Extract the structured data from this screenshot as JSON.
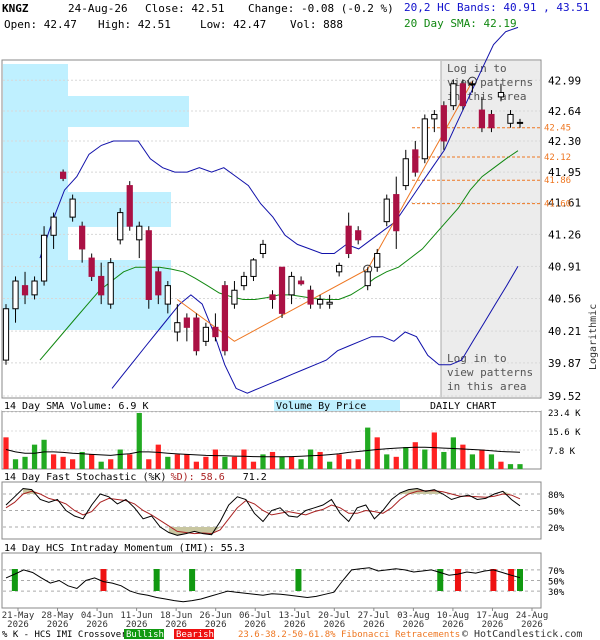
{
  "header": {
    "symbol": "KNGZ",
    "date": "24-Aug-26",
    "close": "Close: 42.51",
    "change": "Change: -0.08 (-0.2 %)",
    "open": "Open: 42.47",
    "high": "High: 42.51",
    "low": "Low: 42.47",
    "vol": "Vol: 888",
    "bands_legend": "20,2 HC Bands: 40.91 , 43.51",
    "sma_legend": "20 Day SMA: 42.19"
  },
  "colors": {
    "up": "#ffffff",
    "down": "#aa1144",
    "volume_up": "#22aa22",
    "volume_down": "#ff2222",
    "bands": "#1111aa",
    "sma": "#118811",
    "fib": "#ee7722",
    "vbp": "#bff0ff",
    "stoch_k": "#000000",
    "stoch_d": "#aa2222",
    "stoch_fill": "#c8c6a0"
  },
  "panels": {
    "volume_title": "14 Day SMA Volume: 6.9 K",
    "vbp_label": "Volume By Price",
    "daily_label": "DAILY CHART",
    "stoch_title_a": "14 Day Fast Stochastic (%K)",
    "stoch_title_b": "%D): 58.6",
    "stoch_title_c": "71.2",
    "imi_title": "14 Day HCS Intraday Momentum (IMI): 55.3",
    "login_text_1": [
      "Log in to",
      "view patterns",
      "in this area"
    ],
    "login_text_2": [
      "Log in to",
      "view patterns",
      "in this area"
    ],
    "log_label": "Logarithmic"
  },
  "footer": {
    "crossover_label": "% K - HCS IMI Crossover:",
    "bullish": "Bullish",
    "bearish": "Bearish",
    "fib_label": "23.6-38.2-50-61.8% Fibonacci Retracements",
    "copyright": "© HotCandlestick.com"
  },
  "chart_data": {
    "type": "candlestick",
    "y_scale": "log",
    "price_ticks": [
      "42.99",
      "42.64",
      "42.30",
      "41.95",
      "41.61",
      "41.26",
      "40.91",
      "40.56",
      "40.21",
      "39.87",
      "39.52"
    ],
    "price_range": [
      39.52,
      43.2
    ],
    "fib_levels": [
      {
        "label": "42.45",
        "price": 42.45
      },
      {
        "label": "42.12",
        "price": 42.12
      },
      {
        "label": "41.86",
        "price": 41.86
      },
      {
        "label": "41.60",
        "price": 41.6
      }
    ],
    "x_labels": [
      [
        "21-May",
        "2026"
      ],
      [
        "28-May",
        "2026"
      ],
      [
        "04-Jun",
        "2026"
      ],
      [
        "11-Jun",
        "2026"
      ],
      [
        "18-Jun",
        "2026"
      ],
      [
        "26-Jun",
        "2026"
      ],
      [
        "06-Jul",
        "2026"
      ],
      [
        "13-Jul",
        "2026"
      ],
      [
        "20-Jul",
        "2026"
      ],
      [
        "27-Jul",
        "2026"
      ],
      [
        "03-Aug",
        "2026"
      ],
      [
        "10-Aug",
        "2026"
      ],
      [
        "17-Aug",
        "2026"
      ],
      [
        "24-Aug",
        "2026"
      ]
    ],
    "candles": [
      {
        "o": 39.9,
        "h": 40.5,
        "l": 39.85,
        "c": 40.45
      },
      {
        "o": 40.45,
        "h": 40.8,
        "l": 40.3,
        "c": 40.75
      },
      {
        "o": 40.7,
        "h": 40.85,
        "l": 40.5,
        "c": 40.6
      },
      {
        "o": 40.6,
        "h": 40.8,
        "l": 40.55,
        "c": 40.75
      },
      {
        "o": 40.75,
        "h": 41.35,
        "l": 40.7,
        "c": 41.25
      },
      {
        "o": 41.25,
        "h": 41.5,
        "l": 41.1,
        "c": 41.45
      },
      {
        "o": 41.95,
        "h": 41.98,
        "l": 41.85,
        "c": 41.88
      },
      {
        "o": 41.45,
        "h": 41.7,
        "l": 41.4,
        "c": 41.65
      },
      {
        "o": 41.35,
        "h": 41.4,
        "l": 40.95,
        "c": 41.1
      },
      {
        "o": 41.0,
        "h": 41.05,
        "l": 40.75,
        "c": 40.8
      },
      {
        "o": 40.8,
        "h": 40.95,
        "l": 40.5,
        "c": 40.6
      },
      {
        "o": 40.5,
        "h": 41.0,
        "l": 40.45,
        "c": 40.95
      },
      {
        "o": 41.2,
        "h": 41.55,
        "l": 41.15,
        "c": 41.5
      },
      {
        "o": 41.8,
        "h": 41.85,
        "l": 41.3,
        "c": 41.35
      },
      {
        "o": 41.2,
        "h": 41.4,
        "l": 41.0,
        "c": 41.35
      },
      {
        "o": 41.3,
        "h": 41.35,
        "l": 40.45,
        "c": 40.55
      },
      {
        "o": 40.85,
        "h": 40.9,
        "l": 40.5,
        "c": 40.6
      },
      {
        "o": 40.5,
        "h": 40.75,
        "l": 40.4,
        "c": 40.7
      },
      {
        "o": 40.2,
        "h": 40.5,
        "l": 40.1,
        "c": 40.3
      },
      {
        "o": 40.35,
        "h": 40.4,
        "l": 40.1,
        "c": 40.25
      },
      {
        "o": 40.35,
        "h": 40.4,
        "l": 39.95,
        "c": 40.0
      },
      {
        "o": 40.1,
        "h": 40.3,
        "l": 40.05,
        "c": 40.25
      },
      {
        "o": 40.25,
        "h": 40.4,
        "l": 40.1,
        "c": 40.15
      },
      {
        "o": 40.7,
        "h": 40.75,
        "l": 39.95,
        "c": 40.0
      },
      {
        "o": 40.5,
        "h": 40.75,
        "l": 40.45,
        "c": 40.65
      },
      {
        "o": 40.7,
        "h": 40.85,
        "l": 40.65,
        "c": 40.8
      },
      {
        "o": 40.8,
        "h": 41.0,
        "l": 40.75,
        "c": 40.98
      },
      {
        "o": 41.05,
        "h": 41.2,
        "l": 41.0,
        "c": 41.15
      },
      {
        "o": 40.6,
        "h": 40.65,
        "l": 40.45,
        "c": 40.55
      },
      {
        "o": 40.9,
        "h": 40.9,
        "l": 40.35,
        "c": 40.4
      },
      {
        "o": 40.6,
        "h": 40.85,
        "l": 40.5,
        "c": 40.8
      },
      {
        "o": 40.75,
        "h": 40.8,
        "l": 40.7,
        "c": 40.72
      },
      {
        "o": 40.65,
        "h": 40.7,
        "l": 40.45,
        "c": 40.5
      },
      {
        "o": 40.5,
        "h": 40.6,
        "l": 40.45,
        "c": 40.55
      },
      {
        "o": 40.5,
        "h": 40.6,
        "l": 40.45,
        "c": 40.52
      },
      {
        "o": 40.85,
        "h": 40.95,
        "l": 40.8,
        "c": 40.92
      },
      {
        "o": 41.35,
        "h": 41.5,
        "l": 41.0,
        "c": 41.05
      },
      {
        "o": 41.3,
        "h": 41.35,
        "l": 41.15,
        "c": 41.2
      },
      {
        "o": 40.7,
        "h": 40.9,
        "l": 40.65,
        "c": 40.85
      },
      {
        "o": 40.9,
        "h": 41.1,
        "l": 40.85,
        "c": 41.05
      },
      {
        "o": 41.4,
        "h": 41.7,
        "l": 41.35,
        "c": 41.65
      },
      {
        "o": 41.7,
        "h": 41.9,
        "l": 41.1,
        "c": 41.3
      },
      {
        "o": 41.8,
        "h": 42.2,
        "l": 41.75,
        "c": 42.1
      },
      {
        "o": 42.2,
        "h": 42.3,
        "l": 41.9,
        "c": 41.95
      },
      {
        "o": 42.1,
        "h": 42.6,
        "l": 42.05,
        "c": 42.55
      },
      {
        "o": 42.55,
        "h": 42.65,
        "l": 42.4,
        "c": 42.6
      },
      {
        "o": 42.7,
        "h": 42.75,
        "l": 42.2,
        "c": 42.3
      },
      {
        "o": 42.7,
        "h": 43.0,
        "l": 42.65,
        "c": 42.95
      },
      {
        "o": 42.95,
        "h": 43.0,
        "l": 42.65,
        "c": 42.7
      },
      {
        "o": 42.95,
        "h": 42.98,
        "l": 42.85,
        "c": 42.95
      },
      {
        "o": 42.65,
        "h": 42.8,
        "l": 42.4,
        "c": 42.45
      },
      {
        "o": 42.6,
        "h": 42.65,
        "l": 42.4,
        "c": 42.45
      },
      {
        "o": 42.8,
        "h": 42.95,
        "l": 42.75,
        "c": 42.85
      },
      {
        "o": 42.5,
        "h": 42.65,
        "l": 42.45,
        "c": 42.6
      },
      {
        "o": 42.5,
        "h": 42.55,
        "l": 42.45,
        "c": 42.51
      }
    ],
    "upper_band": [
      41.0,
      41.4,
      41.75,
      41.9,
      42.15,
      42.25,
      42.3,
      42.3,
      42.3,
      42.1,
      42.0,
      41.95,
      41.95,
      42.0,
      41.95,
      42.0,
      41.9,
      41.8,
      41.6,
      41.45,
      41.25,
      41.15,
      41.1,
      41.05,
      41.05,
      41.15,
      41.1,
      41.2,
      41.3,
      41.4,
      41.6,
      41.8,
      42.0,
      42.2,
      42.5,
      42.8,
      43.1,
      43.4,
      43.55,
      43.6
    ],
    "sma": [
      39.9,
      40.05,
      40.2,
      40.35,
      40.5,
      40.65,
      40.75,
      40.85,
      40.9,
      40.9,
      40.9,
      40.88,
      40.85,
      40.78,
      40.7,
      40.62,
      40.58,
      40.55,
      40.55,
      40.57,
      40.6,
      40.6,
      40.58,
      40.56,
      40.55,
      40.55,
      40.6,
      40.68,
      40.78,
      40.85,
      40.9,
      41.0,
      41.1,
      41.25,
      41.4,
      41.55,
      41.75,
      41.9,
      42.0,
      42.1,
      42.19
    ],
    "lower_band": [
      39.6,
      39.75,
      39.9,
      40.05,
      40.2,
      40.35,
      40.5,
      40.6,
      40.5,
      40.2,
      39.85,
      39.6,
      39.55,
      39.6,
      39.65,
      39.7,
      39.75,
      39.8,
      39.85,
      39.9,
      40.0,
      40.05,
      40.1,
      40.15,
      40.15,
      40.1,
      40.2,
      40.15,
      39.95,
      39.85,
      39.85,
      39.9,
      40.1,
      40.3,
      40.5,
      40.7,
      40.91
    ],
    "fib_line": [
      [
        18,
        40.55
      ],
      [
        24,
        40.1
      ],
      [
        38,
        40.88
      ],
      [
        49,
        42.98
      ]
    ],
    "volume_ticks": [
      "23.4 K",
      "15.6 K",
      "7.8 K"
    ],
    "volume_range": [
      0,
      23.4
    ],
    "volume": [
      {
        "v": 13,
        "up": false
      },
      {
        "v": 4,
        "up": true
      },
      {
        "v": 5,
        "up": true
      },
      {
        "v": 10,
        "up": true
      },
      {
        "v": 12,
        "up": true
      },
      {
        "v": 6,
        "up": false
      },
      {
        "v": 5,
        "up": false
      },
      {
        "v": 4,
        "up": false
      },
      {
        "v": 7,
        "up": true
      },
      {
        "v": 6,
        "up": false
      },
      {
        "v": 3,
        "up": true
      },
      {
        "v": 4,
        "up": false
      },
      {
        "v": 8,
        "up": true
      },
      {
        "v": 6,
        "up": false
      },
      {
        "v": 23,
        "up": true
      },
      {
        "v": 4,
        "up": false
      },
      {
        "v": 10,
        "up": false
      },
      {
        "v": 5,
        "up": true
      },
      {
        "v": 6,
        "up": false
      },
      {
        "v": 6,
        "up": false
      },
      {
        "v": 3,
        "up": false
      },
      {
        "v": 5,
        "up": false
      },
      {
        "v": 8,
        "up": false
      },
      {
        "v": 5,
        "up": true
      },
      {
        "v": 5,
        "up": false
      },
      {
        "v": 8,
        "up": false
      },
      {
        "v": 3,
        "up": false
      },
      {
        "v": 6,
        "up": true
      },
      {
        "v": 7,
        "up": false
      },
      {
        "v": 5,
        "up": true
      },
      {
        "v": 5,
        "up": false
      },
      {
        "v": 4,
        "up": true
      },
      {
        "v": 8,
        "up": true
      },
      {
        "v": 7,
        "up": false
      },
      {
        "v": 3,
        "up": true
      },
      {
        "v": 6,
        "up": false
      },
      {
        "v": 4,
        "up": false
      },
      {
        "v": 4,
        "up": false
      },
      {
        "v": 17,
        "up": true
      },
      {
        "v": 13,
        "up": false
      },
      {
        "v": 6,
        "up": true
      },
      {
        "v": 5,
        "up": false
      },
      {
        "v": 9,
        "up": true
      },
      {
        "v": 11,
        "up": false
      },
      {
        "v": 8,
        "up": true
      },
      {
        "v": 15,
        "up": false
      },
      {
        "v": 7,
        "up": true
      },
      {
        "v": 13,
        "up": true
      },
      {
        "v": 10,
        "up": false
      },
      {
        "v": 6,
        "up": true
      },
      {
        "v": 8,
        "up": false
      },
      {
        "v": 6,
        "up": true
      },
      {
        "v": 3,
        "up": false
      },
      {
        "v": 2,
        "up": true
      },
      {
        "v": 2,
        "up": true
      }
    ],
    "volume_sma": [
      8,
      7,
      6.5,
      6.5,
      7,
      7,
      6.8,
      6.5,
      6.3,
      6,
      5.8,
      5.6,
      6,
      6.3,
      7,
      7,
      6.8,
      6.5,
      6.2,
      6,
      5.8,
      5.6,
      5.5,
      5.4,
      5.3,
      5.2,
      5.1,
      5,
      5,
      5,
      5.1,
      5.2,
      5.4,
      5.6,
      5.9,
      6.3,
      6.8,
      7.2,
      7.6,
      8,
      8.3,
      8.6,
      8.8,
      8.9,
      8.9,
      8.8,
      8.6,
      8.4,
      8.2,
      8,
      7.8,
      7.5,
      7.2,
      7,
      6.9
    ],
    "stoch_ticks": [
      "80%",
      "50%",
      "20%"
    ],
    "stoch_k": [
      60,
      75,
      90,
      88,
      70,
      65,
      70,
      50,
      40,
      35,
      60,
      80,
      75,
      62,
      70,
      55,
      35,
      40,
      20,
      10,
      5,
      8,
      12,
      8,
      6,
      30,
      60,
      75,
      70,
      45,
      30,
      50,
      55,
      40,
      38,
      50,
      55,
      60,
      70,
      45,
      30,
      55,
      60,
      35,
      50,
      70,
      82,
      88,
      90,
      85,
      88,
      80,
      70,
      75,
      78,
      70,
      72,
      80,
      85,
      70,
      58.6
    ],
    "stoch_d": [
      55,
      65,
      80,
      85,
      80,
      72,
      68,
      62,
      50,
      42,
      48,
      65,
      72,
      70,
      68,
      62,
      50,
      42,
      32,
      22,
      12,
      10,
      8,
      9,
      8,
      15,
      35,
      55,
      68,
      62,
      50,
      42,
      45,
      48,
      45,
      42,
      48,
      52,
      60,
      55,
      45,
      45,
      50,
      48,
      45,
      55,
      70,
      80,
      85,
      86,
      86,
      84,
      80,
      76,
      76,
      75,
      74,
      76,
      80,
      78,
      71.2
    ],
    "imi_ticks": [
      "70%",
      "50%",
      "30%"
    ],
    "imi": [
      55,
      62,
      70,
      65,
      55,
      45,
      50,
      40,
      35,
      50,
      55,
      48,
      45,
      40,
      30,
      25,
      22,
      18,
      15,
      12,
      10,
      12,
      15,
      20,
      25,
      30,
      28,
      26,
      24,
      22,
      25,
      24,
      22,
      20,
      18,
      20,
      24,
      28,
      50,
      70,
      72,
      74,
      68,
      70,
      72,
      70,
      66,
      68,
      70,
      65,
      60,
      62,
      66,
      64,
      68,
      70,
      65,
      60,
      55.3
    ],
    "crossovers": [
      {
        "i": 1,
        "bull": true
      },
      {
        "i": 11,
        "bull": false
      },
      {
        "i": 17,
        "bull": true
      },
      {
        "i": 21,
        "bull": true
      },
      {
        "i": 33,
        "bull": true
      },
      {
        "i": 49,
        "bull": true
      },
      {
        "i": 51,
        "bull": false
      },
      {
        "i": 55,
        "bull": false
      },
      {
        "i": 57,
        "bull": false
      },
      {
        "i": 58,
        "bull": true
      }
    ]
  }
}
